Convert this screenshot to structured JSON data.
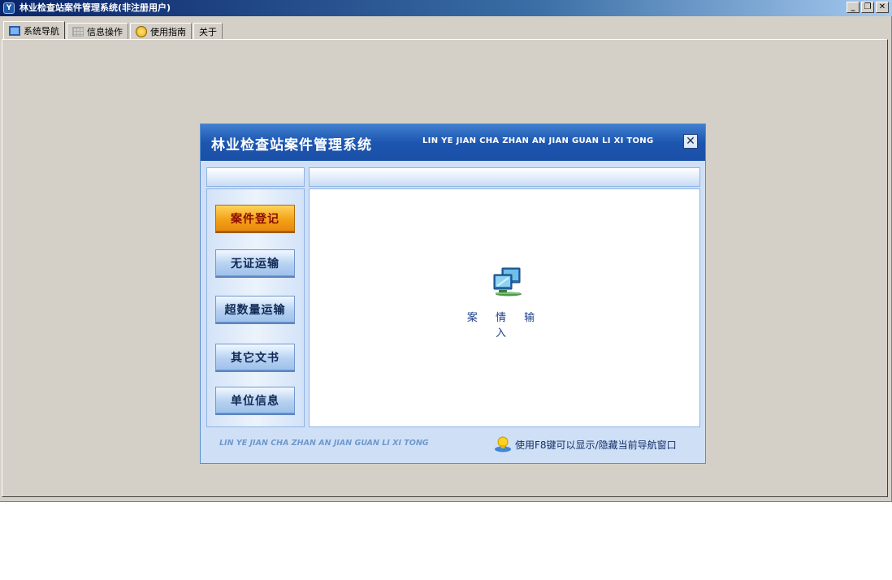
{
  "window": {
    "title": "林业检查站案件管理系统(非注册用户)",
    "app_icon": "yi-logo-icon"
  },
  "window_controls": [
    "minimize",
    "restore",
    "close"
  ],
  "tabs": [
    {
      "label": "系统导航",
      "icon": "monitor-icon",
      "active": true
    },
    {
      "label": "信息操作",
      "icon": "grid-icon",
      "active": false
    },
    {
      "label": "使用指南",
      "icon": "help-icon",
      "active": false
    },
    {
      "label": "关于",
      "icon": "",
      "active": false
    }
  ],
  "nav_window": {
    "title": "林业检查站案件管理系统",
    "pinyin": "LIN YE JIAN CHA ZHAN AN JIAN GUAN LI XI TONG",
    "buttons": [
      {
        "label": "案件登记",
        "active": true
      },
      {
        "label": "无证运输",
        "active": false
      },
      {
        "label": "超数量运输",
        "active": false
      },
      {
        "label": "其它文书",
        "active": false
      },
      {
        "label": "单位信息",
        "active": false
      }
    ],
    "content_item": {
      "label": "案 情 输 入",
      "icon": "computer-network-icon"
    },
    "footer_pinyin": "LIN YE JIAN CHA ZHAN AN JIAN GUAN LI XI TONG",
    "footer_hint": "使用F8键可以显示/隐藏当前导航窗口"
  },
  "colors": {
    "accent": "#1d56b0",
    "active_button": "#f3a21a",
    "face": "#d4d0c8"
  }
}
